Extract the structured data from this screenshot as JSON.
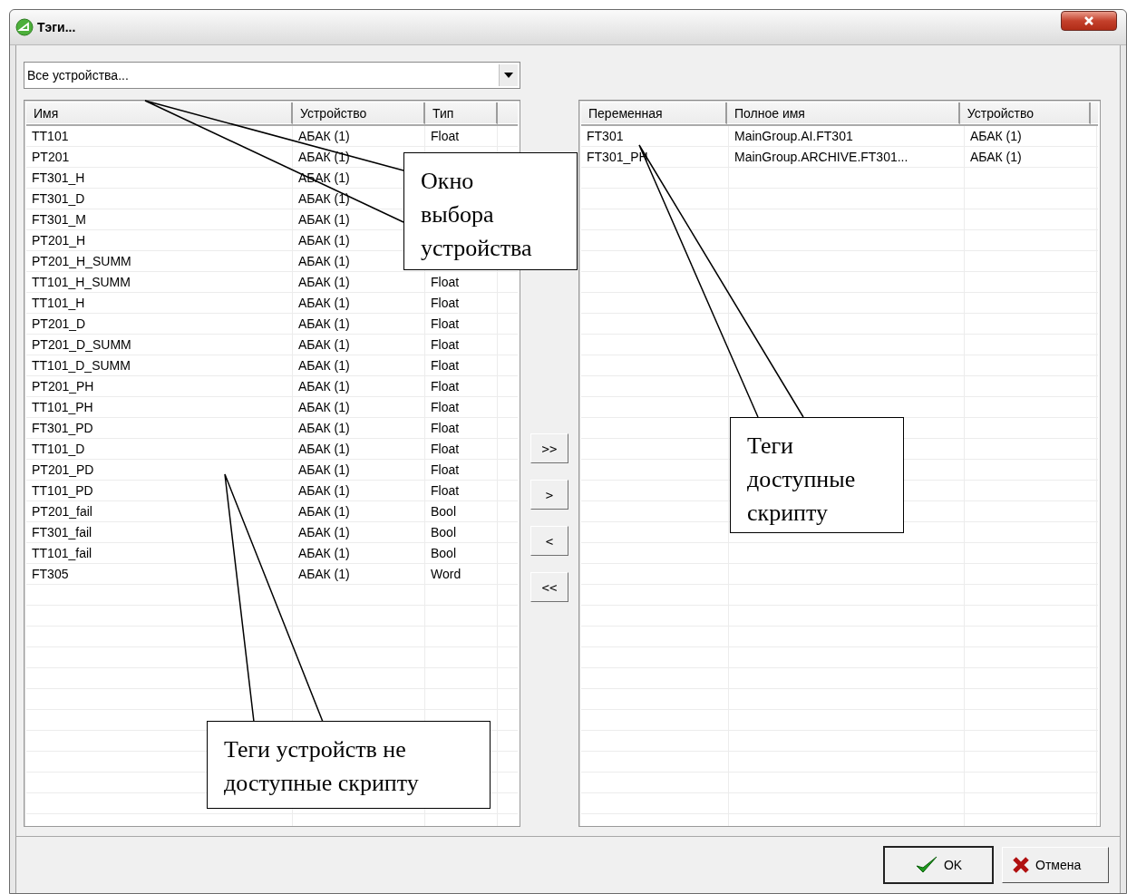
{
  "window": {
    "title": "Тэги..."
  },
  "device_select": {
    "value": "Все устройства..."
  },
  "left_table": {
    "columns": [
      "Имя",
      "Устройство",
      "Тип"
    ],
    "rows": [
      {
        "name": "TT101",
        "device": "АБАК (1)",
        "type": "Float"
      },
      {
        "name": "PT201",
        "device": "АБАК (1)"
      },
      {
        "name": "FT301_H",
        "device": "АБАК (1)"
      },
      {
        "name": "FT301_D",
        "device": "АБАК (1)"
      },
      {
        "name": "FT301_M",
        "device": "АБАК (1)"
      },
      {
        "name": "PT201_H",
        "device": "АБАК (1)"
      },
      {
        "name": "PT201_H_SUMM",
        "device": "АБАК (1)"
      },
      {
        "name": "TT101_H_SUMM",
        "device": "АБАК (1)",
        "type": "Float"
      },
      {
        "name": "TT101_H",
        "device": "АБАК (1)",
        "type": "Float"
      },
      {
        "name": "PT201_D",
        "device": "АБАК (1)",
        "type": "Float"
      },
      {
        "name": "PT201_D_SUMM",
        "device": "АБАК (1)",
        "type": "Float"
      },
      {
        "name": "TT101_D_SUMM",
        "device": "АБАК (1)",
        "type": "Float"
      },
      {
        "name": "PT201_PH",
        "device": "АБАК (1)",
        "type": "Float"
      },
      {
        "name": "TT101_PH",
        "device": "АБАК (1)",
        "type": "Float"
      },
      {
        "name": "FT301_PD",
        "device": "АБАК (1)",
        "type": "Float"
      },
      {
        "name": "TT101_D",
        "device": "АБАК (1)",
        "type": "Float"
      },
      {
        "name": "PT201_PD",
        "device": "АБАК (1)",
        "type": "Float"
      },
      {
        "name": "TT101_PD",
        "device": "АБАК (1)",
        "type": "Float"
      },
      {
        "name": "PT201_fail",
        "device": "АБАК (1)",
        "type": "Bool"
      },
      {
        "name": "FT301_fail",
        "device": "АБАК (1)",
        "type": "Bool"
      },
      {
        "name": "TT101_fail",
        "device": "АБАК (1)",
        "type": "Bool"
      },
      {
        "name": "FT305",
        "device": "АБАК (1)",
        "type": "Word"
      }
    ]
  },
  "transfer_buttons": [
    ">>",
    ">",
    "<",
    "<<"
  ],
  "right_table": {
    "columns": [
      "Переменная",
      "Полное имя",
      "Устройство"
    ],
    "rows": [
      {
        "variable": "FT301",
        "full_name": "MainGroup.AI.FT301",
        "device": "АБАК (1)"
      },
      {
        "variable": "FT301_PH",
        "full_name": "MainGroup.ARCHIVE.FT301...",
        "device": "АБАК (1)"
      }
    ]
  },
  "buttons": [
    {
      "label": "OK",
      "kind": "ok"
    },
    {
      "label": "Отмена",
      "kind": "cancel"
    }
  ],
  "callouts": [
    {
      "text": "Окно\nвыбора\nустройства"
    },
    {
      "text": "Теги\nдоступные\nскрипту"
    },
    {
      "text": "Теги устройств не\nдоступные скрипту"
    }
  ]
}
